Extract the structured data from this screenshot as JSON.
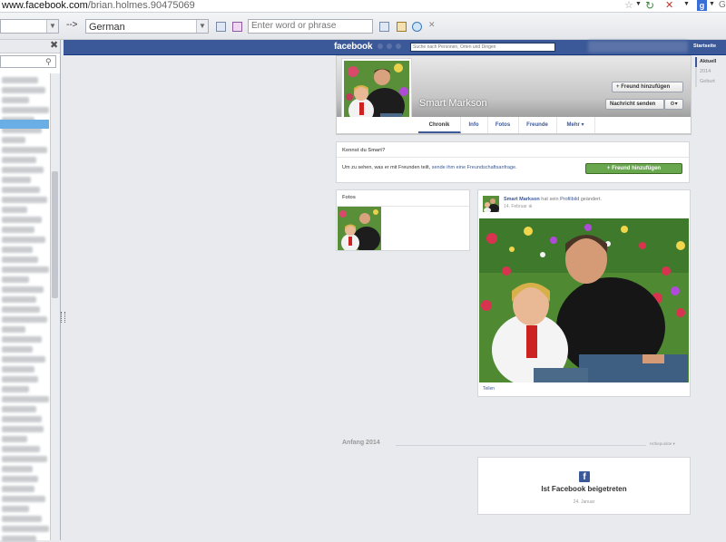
{
  "browser": {
    "url_domain": "www.facebook.com",
    "url_path": "/brian.holmes.90475069",
    "arrow": "-->",
    "language": "German",
    "phrase_placeholder": "Enter word or phrase"
  },
  "fb": {
    "logo": "facebook",
    "search_placeholder": "Suche nach Personen, Orten und Dingen",
    "home": "Startseite",
    "profile_name": "Smart Markson",
    "add_friend": "Freund hinzufügen",
    "send_message": "Nachricht senden",
    "tabs": [
      "Chronik",
      "Info",
      "Fotos",
      "Freunde",
      "Mehr ▾"
    ],
    "timeline_years": [
      "Aktuell",
      "2014",
      "Geburt"
    ],
    "know": {
      "title": "Kennst du Smart?",
      "text": "Um zu sehen, was er mit Freunden teilt,",
      "link": "sende ihm eine Freundschaftsanfrage.",
      "button": "Freund hinzufügen"
    },
    "photos_title": "Fotos",
    "post": {
      "author": "Smart Markson",
      "action": "hat sein",
      "link": "Profilbild",
      "action_end": "geändert.",
      "date": "14. Februar",
      "share": "Teilen"
    },
    "section": {
      "title": "Anfang 2014",
      "highlights": "Höhepunkte ▾"
    },
    "joined": {
      "title": "Ist Facebook beigetreten",
      "date": "24. Januar"
    }
  }
}
